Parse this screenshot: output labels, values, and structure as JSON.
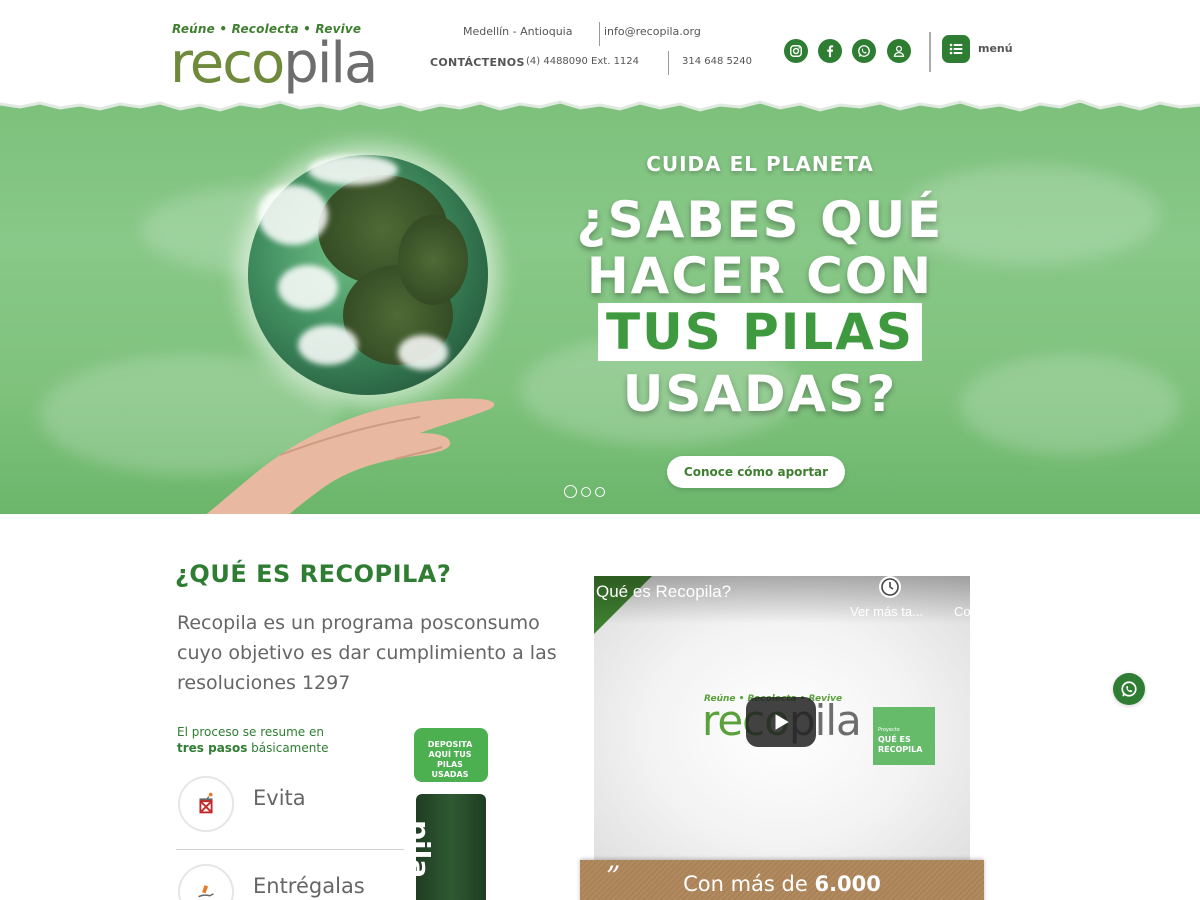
{
  "logo": {
    "tagline": "Reúne • Recolecta • Revive",
    "word_part1": "reco",
    "word_part2": "pila"
  },
  "contact": {
    "city": "Medellín - Antioquia",
    "email": "info@recopila.org",
    "label": "CONTÁCTENOS",
    "phone1": "(4) 4488090 Ext. 1124",
    "phone2": "314 648 5240"
  },
  "social": {
    "icons": [
      "instagram-icon",
      "facebook-icon",
      "whatsapp-icon",
      "user-icon"
    ],
    "color": "#2e7d32"
  },
  "menu": {
    "label": "menú"
  },
  "hero": {
    "kicker": "CUIDA EL PLANETA",
    "line1": "¿SABES QUÉ",
    "line2": "HACER CON",
    "line3": "TUS PILAS",
    "line4": "USADAS?",
    "cta": "Conoce cómo aportar",
    "slides_total": 3,
    "slide_active": 1,
    "bg_color": "#7fc27d"
  },
  "about": {
    "title": "¿QUÉ ES RECOPILA?",
    "text": "Recopila es un programa posconsumo cuyo objetivo es dar cumplimiento a las resoluciones 1297",
    "process_intro_1": "El proceso se resume en",
    "process_intro_bold": "tres pasos",
    "process_intro_2": "básicamente",
    "steps": [
      {
        "label": "Evita",
        "icon": "trash-bin-icon"
      },
      {
        "label": "Entrégalas",
        "icon": "hand-drop-icon"
      }
    ],
    "bin_card_text": "DEPOSITA AQUÍ TUS PILAS USADAS",
    "bin_word": "pila"
  },
  "video": {
    "title": "Qué es Recopila?",
    "watch_later": "Ver más ta...",
    "share": "Co",
    "logo_tagline": "Reúne • Recolecta • Revive",
    "logo_part1": "reco",
    "logo_part2": "pila",
    "badge_small": "Proyecto",
    "badge_text": "QUÉ ES RECOPILA"
  },
  "quote": {
    "mark": "”",
    "text_prefix": "Con más de",
    "text_bold": "6.000"
  },
  "colors": {
    "brand_green": "#2e7d32",
    "accent_green": "#3e7f2f",
    "kraft": "#b0865a"
  }
}
